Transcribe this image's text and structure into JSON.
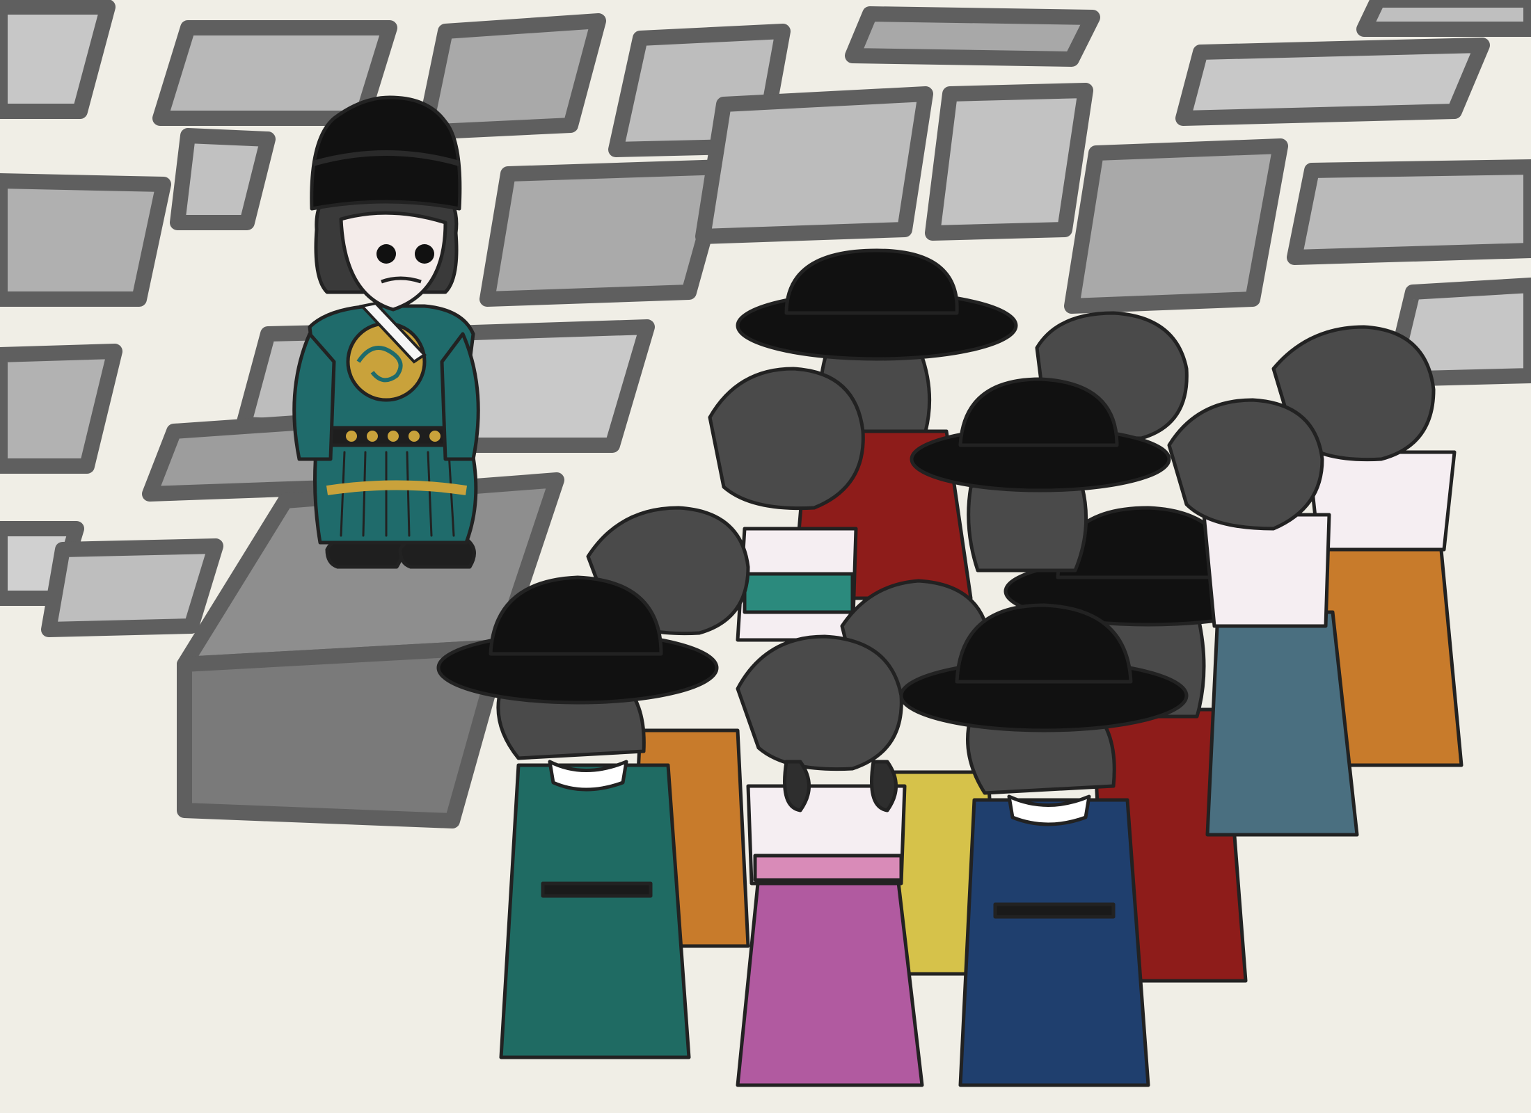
{
  "scene": {
    "background_color": "#f0eee6",
    "stone_color": "#b4b4b4",
    "stone_outline_color": "#5f5f5f"
  },
  "characters": {
    "official": {
      "robe_color": "#1f6b6b",
      "pattern_color": "#c9a23b",
      "hat_color": "#111111"
    },
    "crowd_palette": {
      "teal": "#1f6b63",
      "navy": "#1f3f6e",
      "red": "#8e1c1a",
      "orange": "#c87b2b",
      "lilac": "#b15aa0",
      "slate": "#4a6f80",
      "yellow": "#d6c24a",
      "white_blouse": "#f5eef2",
      "hair": "#4a4a4a",
      "hat": "#111111"
    }
  }
}
